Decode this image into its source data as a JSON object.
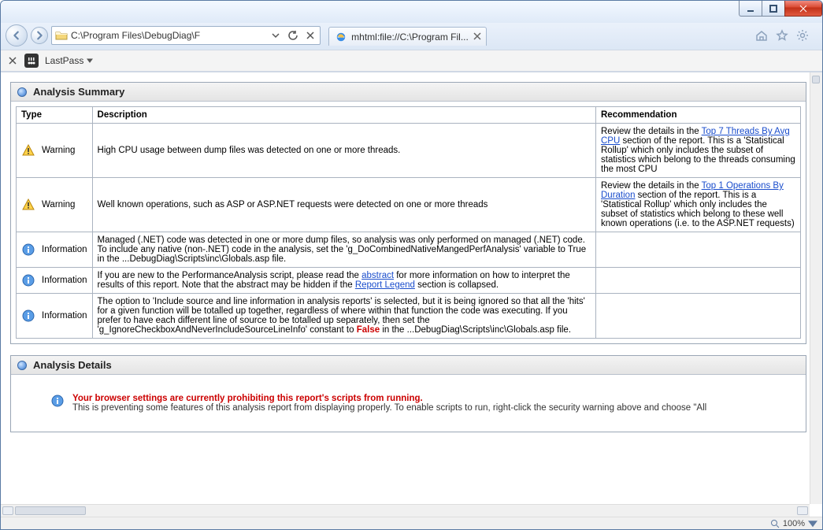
{
  "nav": {
    "address": "C:\\Program Files\\DebugDiag\\F",
    "tab_label": "mhtml:file://C:\\Program Fil..."
  },
  "ext": {
    "name": "LastPass"
  },
  "section1": {
    "title": "Analysis Summary"
  },
  "section2": {
    "title": "Analysis Details"
  },
  "columns": {
    "type": "Type",
    "desc": "Description",
    "rec": "Recommendation"
  },
  "rows": [
    {
      "icon": "warn",
      "type": "Warning",
      "desc": "High CPU usage between dump files was detected on one or more threads.",
      "rec_pre": "Review the details in the ",
      "rec_link": "Top 7 Threads By Avg CPU",
      "rec_post": " section of the report. This is a 'Statistical Rollup' which only includes the subset of statistics which belong to the threads consuming the most CPU"
    },
    {
      "icon": "warn",
      "type": "Warning",
      "desc": "Well known operations, such as ASP or ASP.NET requests were detected on one or more threads",
      "rec_pre": "Review the details in the ",
      "rec_link": "Top 1 Operations By Duration",
      "rec_post": " section of the report. This is a 'Statistical Rollup' which only includes the subset of statistics which belong to these well known operations (i.e. to the ASP.NET requests)"
    },
    {
      "icon": "info",
      "type": "Information",
      "desc": "Managed (.NET) code was detected in one or more dump files, so analysis was only performed on managed (.NET) code. To include any native (non-.NET) code in the analysis, set the 'g_DoCombinedNativeMangedPerfAnalysis' variable to True in the ...DebugDiag\\Scripts\\inc\\Globals.asp file.",
      "rec_pre": "",
      "rec_link": "",
      "rec_post": ""
    },
    {
      "icon": "info",
      "type": "Information",
      "desc_pre": "If you are new to the PerformanceAnalysis script, please read the ",
      "desc_link1": "abstract",
      "desc_mid": " for more information on how to interpret the results of this report.   Note that the abstract may be hidden if the ",
      "desc_link2": "Report Legend",
      "desc_post": " section is collapsed.",
      "rec_pre": "",
      "rec_link": "",
      "rec_post": ""
    },
    {
      "icon": "info",
      "type": "Information",
      "desc_pre": "The option to 'Include source and line information in analysis reports' is selected, but it is being ignored so that all the 'hits' for a given function will be totalled up together, regardless of where within that function the code was executing. If you prefer to have each different line of source to be totalled up separately, then set the 'g_IgnoreCheckboxAndNeverIncludeSourceLineInfo' constant to ",
      "desc_red": "False",
      "desc_post": " in the ...DebugDiag\\Scripts\\inc\\Globals.asp file.",
      "rec_pre": "",
      "rec_link": "",
      "rec_post": ""
    }
  ],
  "details": {
    "line1": "Your browser settings are currently prohibiting this report's scripts from running.",
    "line2": "This is preventing some features of this analysis report from displaying properly. To enable scripts to run, right-click the security warning above and choose \"All"
  },
  "status": {
    "zoom": "100%"
  }
}
